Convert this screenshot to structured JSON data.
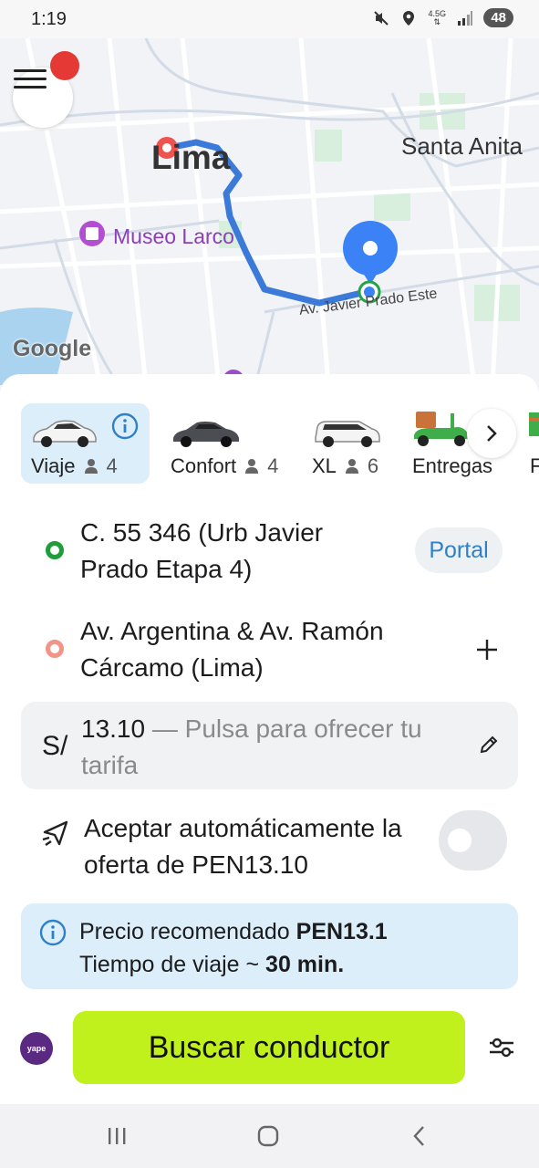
{
  "status_bar": {
    "time": "1:19",
    "network": "4.5G",
    "battery": "48",
    "icons": [
      "mute-icon",
      "location-icon",
      "network-arrows-icon",
      "signal-icon"
    ]
  },
  "map": {
    "city_label": "Lima",
    "district_label": "Santa Anita",
    "poi_label": "Museo Larco",
    "street_label": "Av. Javier Prado Este",
    "attribution": "Google",
    "route_color": "#3b7ad9",
    "pickup_color": "#3b82f6",
    "destination_color": "#ef5350"
  },
  "menu": {
    "icon": "hamburger-icon",
    "badge_color": "#e53935"
  },
  "tariffs": [
    {
      "label": "Viaje",
      "pax": "4",
      "selected": true,
      "icon": "car-sedan-white-icon"
    },
    {
      "label": "Confort",
      "pax": "4",
      "selected": false,
      "icon": "car-sedan-dark-icon"
    },
    {
      "label": "XL",
      "pax": "6",
      "selected": false,
      "icon": "car-van-icon"
    },
    {
      "label": "Entregas",
      "pax": "",
      "selected": false,
      "icon": "delivery-scooter-icon"
    },
    {
      "label": "F",
      "pax": "",
      "selected": false,
      "icon": "truck-icon"
    }
  ],
  "pickup": {
    "address": "C. 55 346 (Urb Javier Prado Etapa 4)",
    "action": "Portal"
  },
  "destination": {
    "address": "Av. Argentina & Av. Ramón Cárcamo (Lima)"
  },
  "fare": {
    "currency": "S/",
    "amount": "13.10",
    "hint": " — Pulsa para ofrecer tu tarifa"
  },
  "auto_accept": {
    "label": "Aceptar automáticamente la oferta de PEN13.10",
    "enabled": false
  },
  "recommendation": {
    "price_label": "Precio recomendado ",
    "price_value": "PEN13.1",
    "time_label": "Tiempo de viaje ~ ",
    "time_value": "30 min."
  },
  "actions": {
    "search_label": "Buscar conductor",
    "payment_badge": "yape",
    "accent": "#c1f11d"
  }
}
